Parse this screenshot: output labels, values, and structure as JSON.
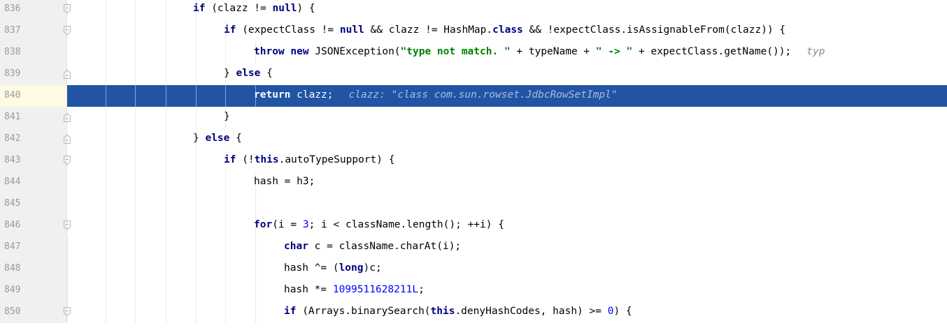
{
  "editor": {
    "current_line": "840",
    "lines": [
      {
        "num": "836",
        "parts": [
          "if",
          " (clazz != ",
          "null",
          ") {"
        ]
      },
      {
        "num": "837",
        "parts": [
          "if",
          " (expectClass != ",
          "null",
          " && clazz != HashMap.",
          "class",
          " && !expectClass.isAssignableFrom(clazz)) {"
        ]
      },
      {
        "num": "838",
        "parts": [
          "throw new",
          " JSONException(",
          "\"type not match. \"",
          " + typeName + ",
          "\" -> \"",
          " + expectClass.getName());",
          "typ"
        ]
      },
      {
        "num": "839",
        "parts": [
          "} ",
          "else",
          " {"
        ]
      },
      {
        "num": "840",
        "parts": [
          "return",
          " clazz;",
          "clazz: ",
          "\"class com.sun.rowset.JdbcRowSetImpl\""
        ]
      },
      {
        "num": "841",
        "parts": [
          "}"
        ]
      },
      {
        "num": "842",
        "parts": [
          "} ",
          "else",
          " {"
        ]
      },
      {
        "num": "843",
        "parts": [
          "if",
          " (!",
          "this",
          ".autoTypeSupport) {"
        ]
      },
      {
        "num": "844",
        "parts": [
          "hash = h3;"
        ]
      },
      {
        "num": "845",
        "parts": []
      },
      {
        "num": "846",
        "parts": [
          "for",
          "(i = ",
          "3",
          "; i < className.length(); ++i) {"
        ]
      },
      {
        "num": "847",
        "parts": [
          "char",
          " c = className.charAt(i);"
        ]
      },
      {
        "num": "848",
        "parts": [
          "hash ^= (",
          "long",
          ")c;"
        ]
      },
      {
        "num": "849",
        "parts": [
          "hash *= ",
          "1099511628211L",
          ";"
        ]
      },
      {
        "num": "850",
        "parts": [
          "if",
          " (Arrays.binarySearch(",
          "this",
          ".denyHashCodes, hash) >= ",
          "0",
          ") {"
        ]
      }
    ]
  },
  "colors": {
    "keyword": "#000080",
    "string": "#008000",
    "number": "#0000ff",
    "hint": "#8c8c8c",
    "selection": "#2154a3",
    "gutter": "#f0f0f0"
  },
  "icons": {
    "fold_open": "fold-open-icon",
    "fold_close": "fold-close-icon"
  }
}
